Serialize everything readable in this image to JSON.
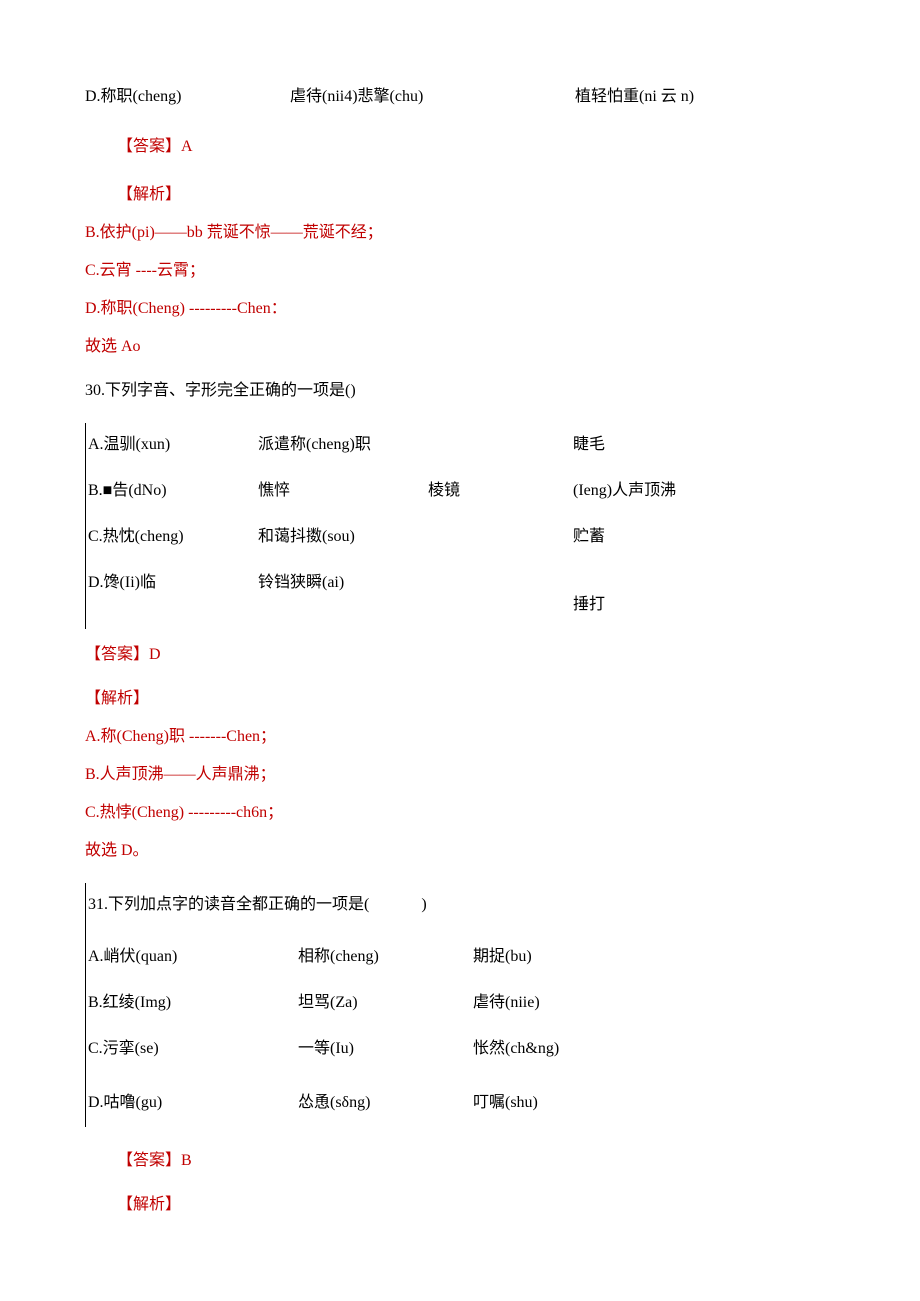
{
  "topline": {
    "a": "D.称职(cheng)",
    "b": "虐待(nii4)悲擎(chu)",
    "c": "植轻怕重(ni 云 n)"
  },
  "ans29": "【答案】A",
  "jx29": "【解析】",
  "b29": "B.依护(pi)——bb 荒诞不惊——荒诞不经；",
  "c29": "C.云宵 ----云霄；",
  "d29": "D.称职(Cheng) ---------Chen：",
  "gx29": "故选 Ao",
  "q30": "30.下列字音、字形完全正确的一项是()",
  "t1": {
    "r1": {
      "a": "A.温驯(xun)",
      "b": "派遣称(cheng)职",
      "c": "",
      "d": "睫毛"
    },
    "r2": {
      "a": "B.■告(dNo)",
      "b": "憔悴",
      "c": "棱镜",
      "d": "(Ieng)人声顶沸"
    },
    "r3": {
      "a": "C.热忱(cheng)",
      "b": "和蔼抖擞(sou)",
      "c": "",
      "d": "贮蓄"
    },
    "r4": {
      "a": "D.馋(Ii)临",
      "b": "铃铛狭瞬(ai)",
      "c": "",
      "d": "捶打"
    }
  },
  "ans30": "【答案】D",
  "jx30": "【解析】",
  "a30": "A.称(Cheng)职 -------Chen；",
  "b30": "B.人声顶沸——人声鼎沸；",
  "c30": "C.热悖(Cheng) ---------ch6n；",
  "gx30": "故选 D。",
  "q31": "31.下列加点字的读音全都正确的一项是(             )",
  "t2": {
    "r1": {
      "a": "A.峭伏(quan)",
      "b": "相称(cheng)",
      "c": "期捉(bu)"
    },
    "r2": {
      "a": "B.红绫(Img)",
      "b": "坦骂(Za)",
      "c": "虐待(niie)"
    },
    "r3": {
      "a": "C.污挛(se)",
      "b": "一等(Iu)",
      "c": "怅然(ch&ng)"
    },
    "r4": {
      "a": "D.咕噜(gu)",
      "b": "怂恿(sδng)",
      "c": "叮嘱(shu)"
    }
  },
  "ans31": "【答案】B",
  "jx31": "【解析】"
}
